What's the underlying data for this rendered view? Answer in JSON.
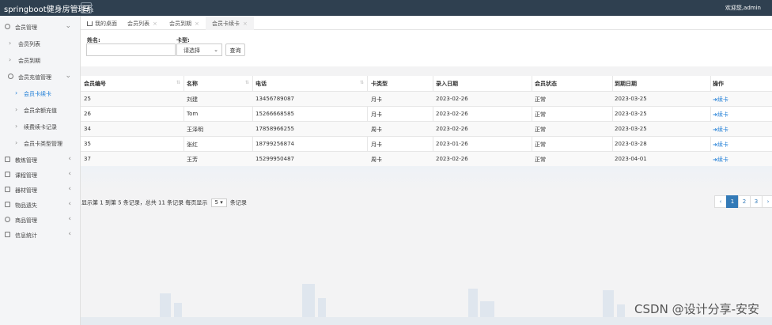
{
  "app": {
    "title": "springboot健身房管理系",
    "welcome": "欢迎您,admin"
  },
  "sidebar": {
    "items": [
      {
        "label": "会员管理",
        "icon": "user-icon"
      },
      {
        "label": "会员列表"
      },
      {
        "label": "会员到期"
      },
      {
        "label": "会员充值管理",
        "icon": "recharge-icon"
      },
      {
        "label": "会员卡续卡"
      },
      {
        "label": "会员余额充值"
      },
      {
        "label": "续费续卡记录"
      },
      {
        "label": "会员卡类型管理"
      },
      {
        "label": "教练管理",
        "icon": "coach-icon"
      },
      {
        "label": "课程管理",
        "icon": "course-icon"
      },
      {
        "label": "器材管理",
        "icon": "equipment-icon"
      },
      {
        "label": "物品遗失",
        "icon": "lost-items-icon"
      },
      {
        "label": "商品管理",
        "icon": "goods-icon"
      },
      {
        "label": "信息统计",
        "icon": "stats-icon"
      }
    ]
  },
  "tabs": [
    {
      "label": "我的桌面"
    },
    {
      "label": "会员列表"
    },
    {
      "label": "会员到期"
    },
    {
      "label": "会员卡续卡",
      "active": true
    }
  ],
  "search": {
    "name_label": "姓名:",
    "name_value": "",
    "card_label": "卡型:",
    "card_selected": "请选择",
    "button": "查询"
  },
  "table": {
    "headers": [
      "会员编号",
      "名称",
      "电话",
      "卡类型",
      "录入日期",
      "会员状态",
      "到期日期",
      "操作"
    ],
    "rows": [
      [
        "25",
        "刘建",
        "13456789087",
        "月卡",
        "2023-02-26",
        "正常",
        "2023-03-25",
        "➜续卡"
      ],
      [
        "26",
        "Tom",
        "15266668585",
        "月卡",
        "2023-02-26",
        "正常",
        "2023-03-25",
        "➜续卡"
      ],
      [
        "34",
        "王泽明",
        "17858966255",
        "周卡",
        "2023-02-26",
        "正常",
        "2023-03-25",
        "➜续卡"
      ],
      [
        "35",
        "张红",
        "18799256874",
        "月卡",
        "2023-01-26",
        "正常",
        "2023-03-28",
        "➜续卡"
      ],
      [
        "37",
        "王芳",
        "15299950487",
        "周卡",
        "2023-02-26",
        "正常",
        "2023-04-01",
        "➜续卡"
      ]
    ]
  },
  "pager": {
    "info_before": "显示第 1 到第 5 条记录，总共 11 条记录 每页显示",
    "page_size": "5",
    "info_after": "条记录",
    "prev": "‹",
    "pages": [
      "1",
      "2",
      "3"
    ],
    "next": "›"
  },
  "watermark": "CSDN @设计分享-安安",
  "colors": {
    "topbar": "#2f4050",
    "accent": "#337ab7",
    "link": "#1a7bd6"
  }
}
